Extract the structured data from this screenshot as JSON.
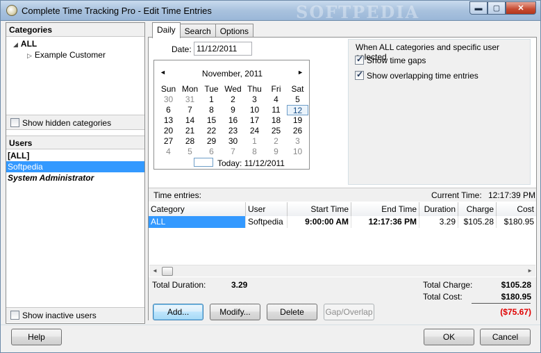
{
  "window": {
    "title": "Complete Time Tracking Pro - Edit Time Entries",
    "watermark": "SOFTPEDIA",
    "minimize": "▬",
    "maximize": "▢",
    "close": "✕"
  },
  "categories": {
    "header": "Categories",
    "items": [
      {
        "label": "ALL",
        "expanded": true
      },
      {
        "label": "Example Customer",
        "expanded": false
      }
    ],
    "show_hidden_label": "Show hidden categories",
    "show_hidden_checked": false
  },
  "users": {
    "header": "Users",
    "items": [
      {
        "label": "[ALL]",
        "style": "bold"
      },
      {
        "label": "Softpedia",
        "selected": true
      },
      {
        "label": "System Administrator",
        "style": "bold-italic"
      }
    ],
    "show_inactive_label": "Show inactive users",
    "show_inactive_checked": false
  },
  "tabs": [
    {
      "label": "Daily",
      "active": true
    },
    {
      "label": "Search",
      "active": false
    },
    {
      "label": "Options",
      "active": false
    }
  ],
  "daily": {
    "date_label": "Date:",
    "date_value": "11/12/2011",
    "calendar": {
      "month_label": "November, 2011",
      "prev_icon": "◄",
      "next_icon": "►",
      "weekdays": [
        "Sun",
        "Mon",
        "Tue",
        "Wed",
        "Thu",
        "Fri",
        "Sat"
      ],
      "days": [
        {
          "d": "30",
          "dim": true
        },
        {
          "d": "31",
          "dim": true
        },
        {
          "d": "1"
        },
        {
          "d": "2"
        },
        {
          "d": "3"
        },
        {
          "d": "4"
        },
        {
          "d": "5"
        },
        {
          "d": "6"
        },
        {
          "d": "7"
        },
        {
          "d": "8"
        },
        {
          "d": "9"
        },
        {
          "d": "10"
        },
        {
          "d": "11"
        },
        {
          "d": "12",
          "today": true
        },
        {
          "d": "13"
        },
        {
          "d": "14"
        },
        {
          "d": "15"
        },
        {
          "d": "16"
        },
        {
          "d": "17"
        },
        {
          "d": "18"
        },
        {
          "d": "19"
        },
        {
          "d": "20"
        },
        {
          "d": "21"
        },
        {
          "d": "22"
        },
        {
          "d": "23"
        },
        {
          "d": "24"
        },
        {
          "d": "25"
        },
        {
          "d": "26"
        },
        {
          "d": "27"
        },
        {
          "d": "28"
        },
        {
          "d": "29"
        },
        {
          "d": "30"
        },
        {
          "d": "1",
          "dim": true
        },
        {
          "d": "2",
          "dim": true
        },
        {
          "d": "3",
          "dim": true
        },
        {
          "d": "4",
          "dim": true
        },
        {
          "d": "5",
          "dim": true
        },
        {
          "d": "6",
          "dim": true
        },
        {
          "d": "7",
          "dim": true
        },
        {
          "d": "8",
          "dim": true
        },
        {
          "d": "9",
          "dim": true
        },
        {
          "d": "10",
          "dim": true
        }
      ],
      "today_label": "Today: 11/12/2011"
    },
    "options_group": {
      "title": "When ALL categories and specific user selected",
      "show_gaps_label": "Show time gaps",
      "show_gaps_checked": true,
      "show_overlap_label": "Show overlapping time entries",
      "show_overlap_checked": true
    }
  },
  "entries": {
    "label": "Time entries:",
    "current_time_label": "Current Time:",
    "current_time_value": "12:17:39 PM",
    "columns": [
      "Category",
      "User",
      "Start Time",
      "End Time",
      "Duration",
      "Charge",
      "Cost"
    ],
    "rows": [
      {
        "category": "ALL",
        "user": "Softpedia",
        "start": "9:00:00 AM",
        "end": "12:17:36 PM",
        "duration": "3.29",
        "charge": "$105.28",
        "cost": "$180.95"
      }
    ],
    "scroll_left_icon": "◄",
    "scroll_right_icon": "►"
  },
  "totals": {
    "duration_label": "Total Duration:",
    "duration_value": "3.29",
    "charge_label": "Total Charge:",
    "charge_value": "$105.28",
    "cost_label": "Total Cost:",
    "cost_value": "$180.95",
    "difference_value": "($75.67)",
    "difference_color": "#e00000"
  },
  "actions": {
    "add": "Add...",
    "modify": "Modify...",
    "delete": "Delete",
    "gap_overlap": "Gap/Overlap",
    "help": "Help",
    "ok": "OK",
    "cancel": "Cancel"
  }
}
